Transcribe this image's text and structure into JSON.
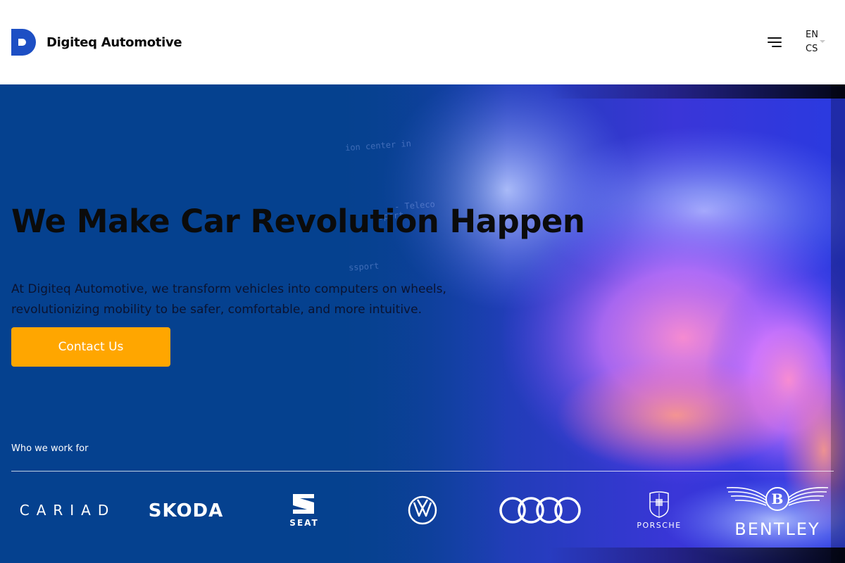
{
  "header": {
    "logo_text": "Digiteq Automotive",
    "menu_icon": "hamburger-menu-icon",
    "languages": [
      "EN",
      "CS"
    ]
  },
  "hero": {
    "headline": "We Make Car Revolution Happen",
    "subtext": "At Digiteq Automotive, we transform vehicles into computers on wheels, revolutionizing mobility to be safer, comfortable, and more intuitive.",
    "cta_label": "Contact Us",
    "background_code_lines": [
      "ion center in",
      "- Teleco",
      "ssport",
      "ssport"
    ]
  },
  "clients": {
    "label": "Who we work for",
    "logos": [
      {
        "name": "cariad-logo",
        "text": "CARIAD"
      },
      {
        "name": "skoda-logo",
        "text": "SKODA"
      },
      {
        "name": "seat-logo",
        "text": "SEAT"
      },
      {
        "name": "volkswagen-logo",
        "text": ""
      },
      {
        "name": "audi-logo",
        "text": ""
      },
      {
        "name": "porsche-logo",
        "text": "PORSCHE"
      },
      {
        "name": "bentley-logo",
        "text": "BENTLEY"
      }
    ]
  },
  "colors": {
    "brand_blue": "#1d4fc4",
    "hero_blue": "#05418f",
    "cta_orange": "#ffa600",
    "headline": "#0b0b0b"
  }
}
